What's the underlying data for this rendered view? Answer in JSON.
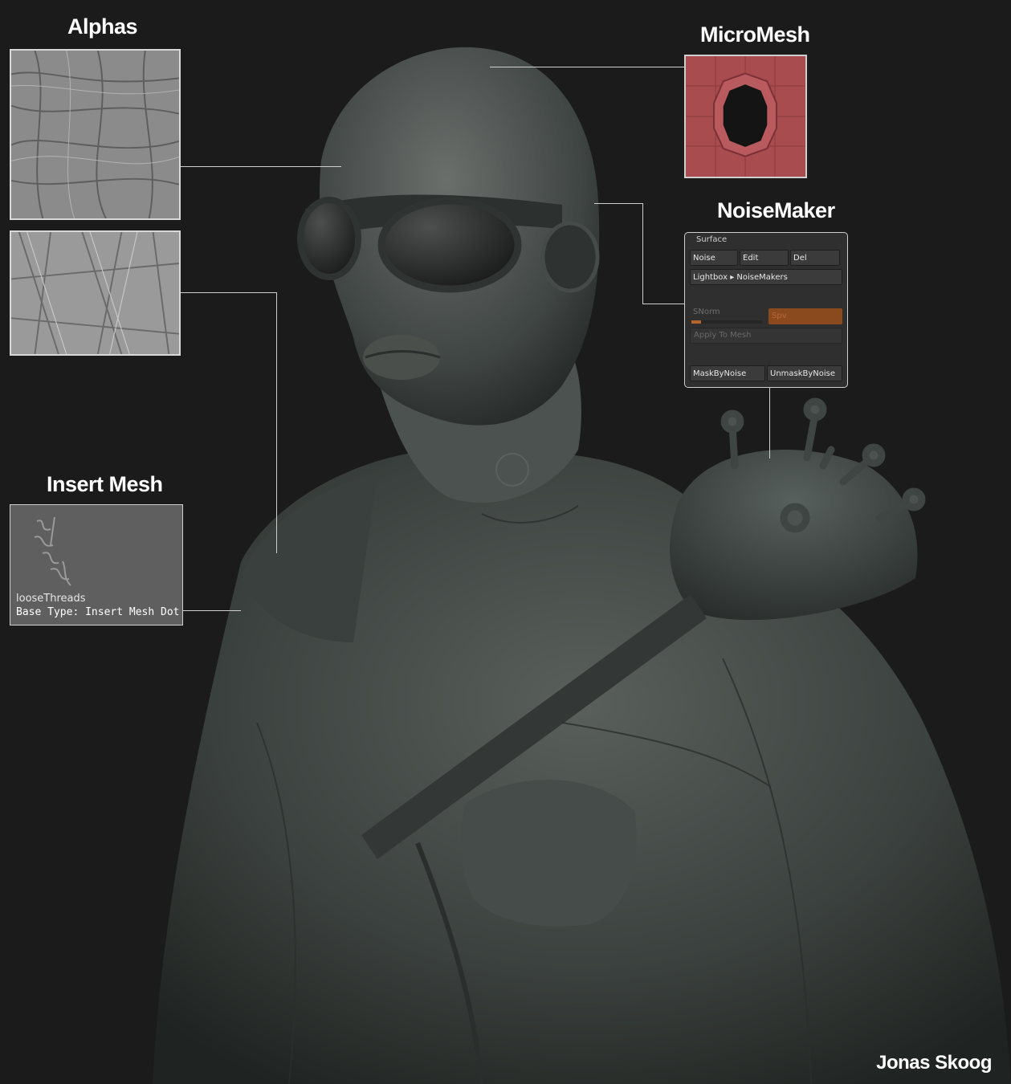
{
  "labels": {
    "alphas": "Alphas",
    "micromesh": "MicroMesh",
    "noisemaker": "NoiseMaker",
    "insert_mesh": "Insert Mesh"
  },
  "insert_mesh_panel": {
    "brush_name": "looseThreads",
    "base_type": "Base Type: Insert Mesh Dot"
  },
  "noisemaker_panel": {
    "title": "Surface",
    "buttons": [
      "Noise",
      "Edit",
      "Del"
    ],
    "lightbox": "Lightbox ▸ NoiseMakers",
    "snorm_label": "SNorm",
    "snorm_value": "Spv",
    "apply_label": "Apply To Mesh",
    "mask_button": "MaskByNoise",
    "unmask_button": "UnmaskByNoise"
  },
  "author": "Jonas Skoog",
  "colors": {
    "background": "#1b1b1b",
    "micromesh_fill": "#a84c50",
    "sculpt_base": "#3e4441",
    "accent_orange": "#b5642c"
  }
}
